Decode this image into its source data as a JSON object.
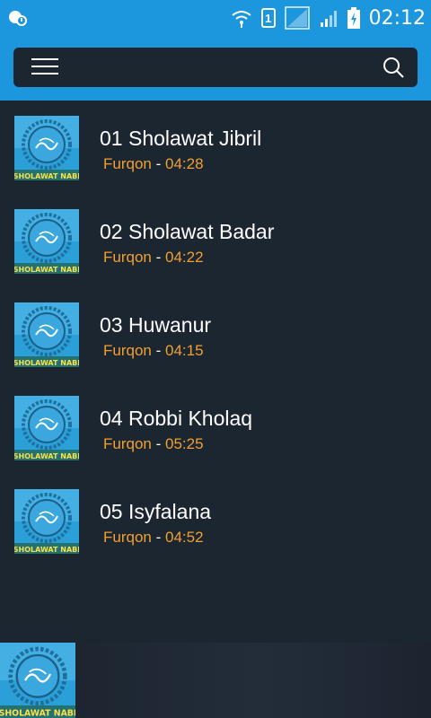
{
  "status_bar": {
    "time": "02:12",
    "sim_label": "1",
    "icons": [
      "notification-icon",
      "wifi-icon",
      "sim-icon",
      "signal-icon",
      "signal-icon-2",
      "battery-charging-icon"
    ]
  },
  "header": {
    "menu_icon": "hamburger-menu-icon",
    "search_icon": "search-icon"
  },
  "thumbnail_caption": "SHOLAWAT NABI",
  "tracks": [
    {
      "title": "01 Sholawat Jibril",
      "artist": "Furqon",
      "separator": " - ",
      "duration": "04:28"
    },
    {
      "title": "02 Sholawat Badar",
      "artist": "Furqon",
      "separator": " - ",
      "duration": "04:22"
    },
    {
      "title": "03 Huwanur",
      "artist": "Furqon",
      "separator": " - ",
      "duration": "04:15"
    },
    {
      "title": "04 Robbi Kholaq",
      "artist": "Furqon",
      "separator": " - ",
      "duration": "05:25"
    },
    {
      "title": "05 Isyfalana",
      "artist": "Furqon",
      "separator": " - ",
      "duration": "04:52"
    }
  ],
  "colors": {
    "accent": "#1c96dc",
    "background": "#1c2631",
    "artist": "#f0a030",
    "text": "#ffffff"
  }
}
